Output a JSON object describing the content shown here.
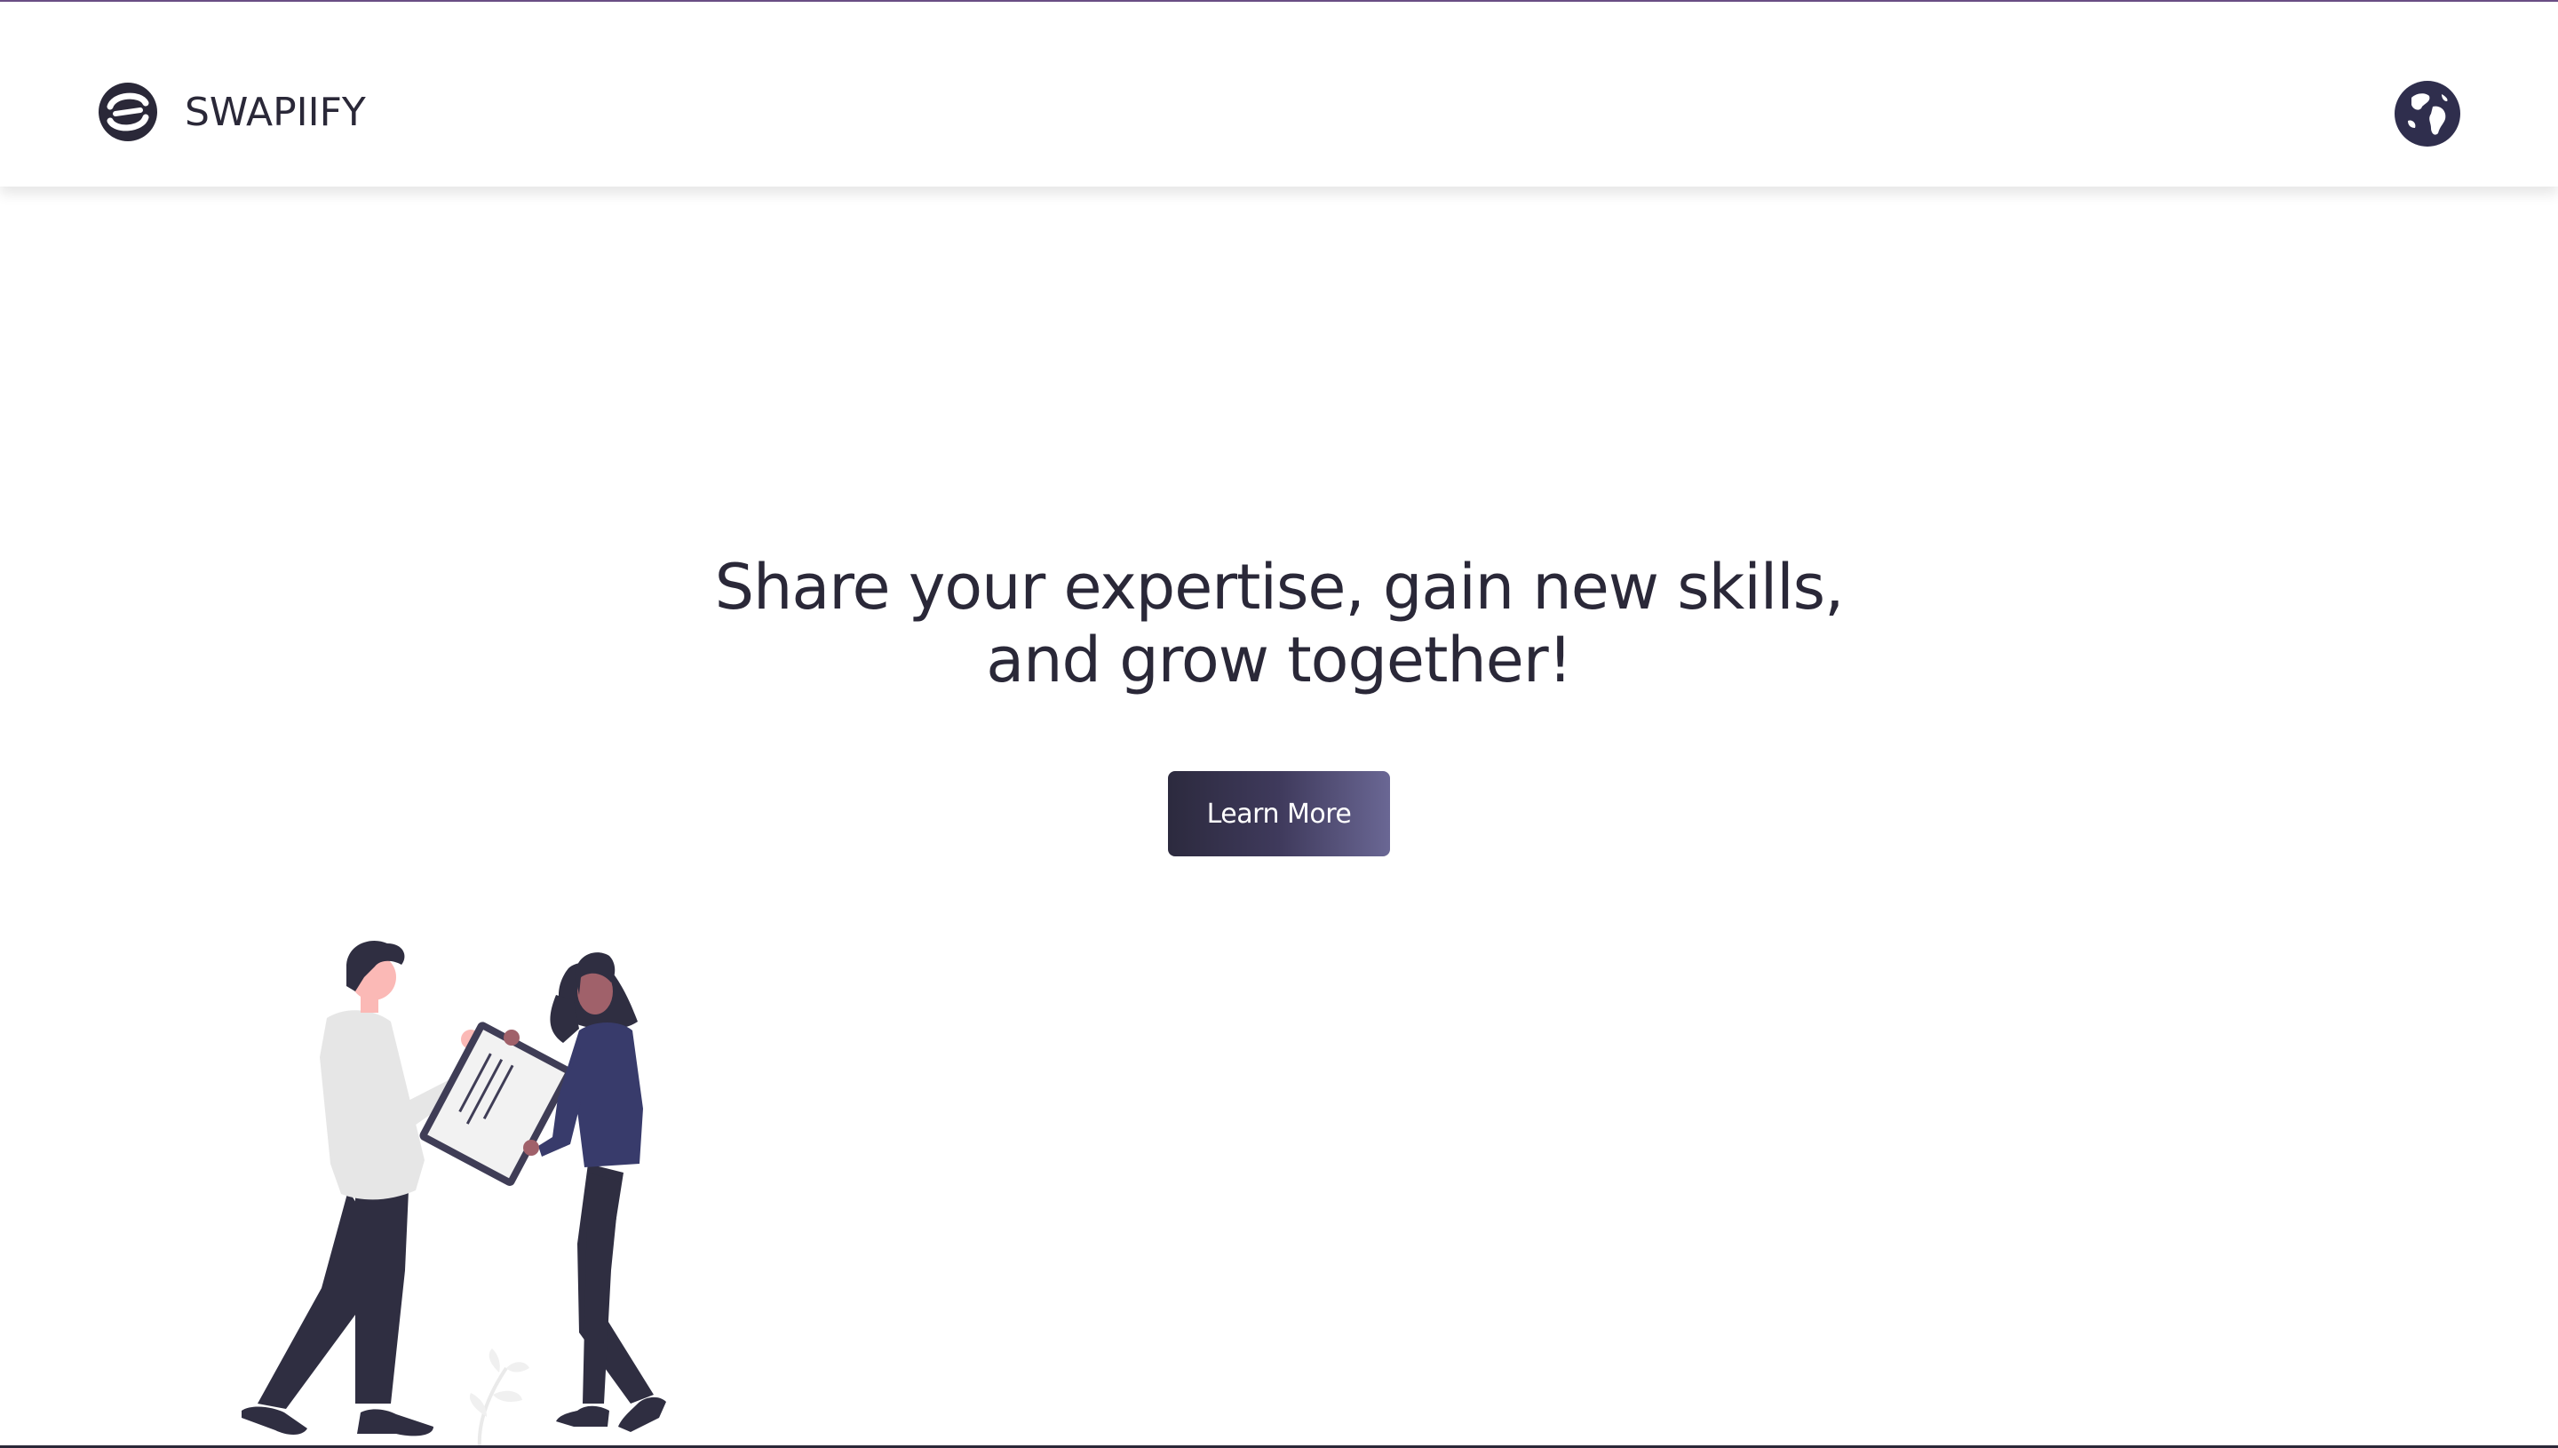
{
  "brand": {
    "name": "SWAPIIFY",
    "logo_icon": "swapiify-logo-icon"
  },
  "nav": {
    "language_icon": "globe-icon"
  },
  "hero": {
    "title_line1": "Share your expertise, gain new skills,",
    "title_line2": "and grow together!",
    "cta_label": "Learn More"
  },
  "illustration": {
    "name": "two-people-sharing-document-illustration"
  },
  "colors": {
    "primary_dark": "#2a2838",
    "accent_purple": "#6b4f86",
    "button_gradient_start": "#2c2a3e",
    "button_gradient_end": "#6a6794",
    "skin_light": "#fbb9b6",
    "skin_dark": "#a0616a",
    "shirt_light": "#e6e6e6",
    "top_navy": "#383b6b"
  }
}
